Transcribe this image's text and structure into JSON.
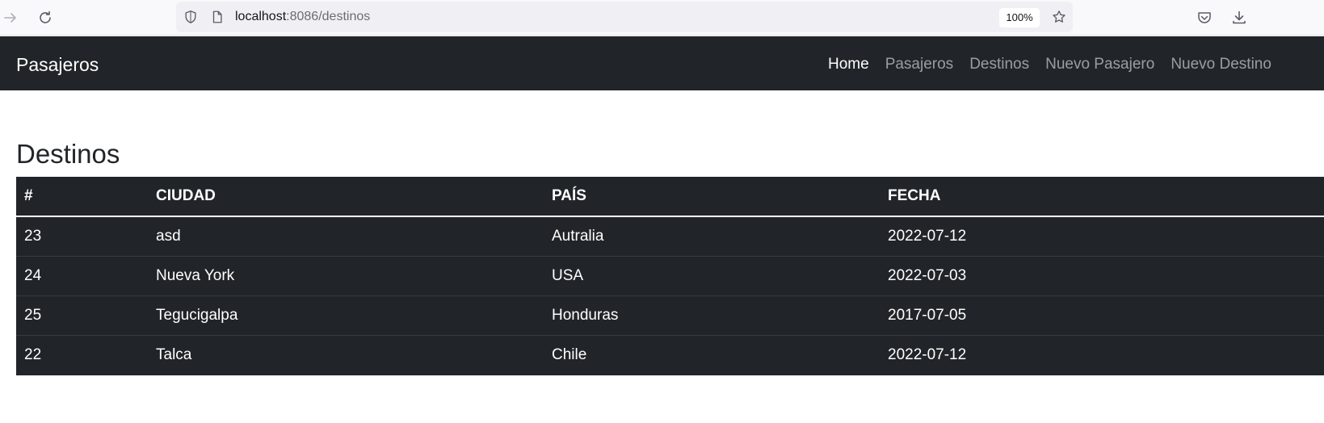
{
  "browser": {
    "url_host": "localhost",
    "url_rest": ":8086/destinos",
    "zoom": "100%"
  },
  "navbar": {
    "brand": "Pasajeros",
    "links": [
      {
        "label": "Home",
        "active": true
      },
      {
        "label": "Pasajeros",
        "active": false
      },
      {
        "label": "Destinos",
        "active": false
      },
      {
        "label": "Nuevo Pasajero",
        "active": false
      },
      {
        "label": "Nuevo Destino",
        "active": false
      }
    ]
  },
  "main": {
    "title": "Destinos",
    "table": {
      "headers": [
        "#",
        "CIUDAD",
        "PAÍS",
        "FECHA"
      ],
      "rows": [
        [
          "23",
          "asd",
          "Autralia",
          "2022-07-12"
        ],
        [
          "24",
          "Nueva York",
          "USA",
          "2022-07-03"
        ],
        [
          "25",
          "Tegucigalpa",
          "Honduras",
          "2017-07-05"
        ],
        [
          "22",
          "Talca",
          "Chile",
          "2022-07-12"
        ]
      ]
    }
  },
  "colors": {
    "navbar_bg": "#212529",
    "table_bg": "#212529",
    "nav_active": "#ffffff",
    "nav_inactive": "rgba(255,255,255,0.55)"
  },
  "icons": [
    "forward-icon",
    "reload-icon",
    "shield-icon",
    "page-icon",
    "star-icon",
    "pocket-icon",
    "download-icon"
  ]
}
